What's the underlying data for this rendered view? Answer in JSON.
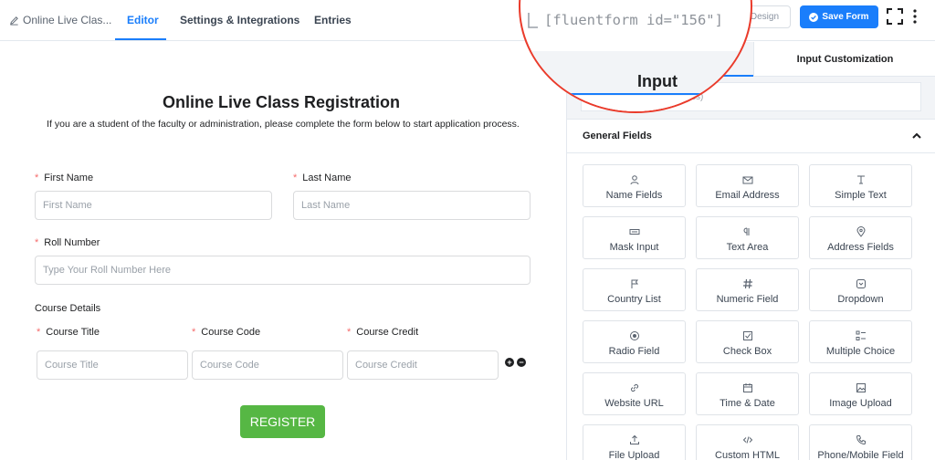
{
  "topbar": {
    "form_name": "Online Live Clas...",
    "tabs": [
      "Editor",
      "Settings & Integrations",
      "Entries"
    ],
    "preview_label": "Preview & Design",
    "save_label": "Save Form"
  },
  "form": {
    "title": "Online Live Class Registration",
    "description": "If you are a student of the faculty or administration, please complete the form below to start application process.",
    "first_name_label": "First Name",
    "first_name_placeholder": "First Name",
    "last_name_label": "Last Name",
    "last_name_placeholder": "Last Name",
    "roll_label": "Roll Number",
    "roll_placeholder": "Type Your Roll Number Here",
    "course_details_label": "Course Details",
    "course_title_label": "Course Title",
    "course_title_placeholder": "Course Title",
    "course_code_label": "Course Code",
    "course_code_placeholder": "Course Code",
    "course_credit_label": "Course Credit",
    "course_credit_placeholder": "Course Credit",
    "register_label": "REGISTER"
  },
  "sidebar": {
    "tab_input": "Input",
    "tab_customization": "Input Customization",
    "search_hint": "(Address)",
    "section_title": "General Fields",
    "fields": [
      {
        "label": "Name Fields",
        "icon": "user-icon"
      },
      {
        "label": "Email Address",
        "icon": "envelope-icon"
      },
      {
        "label": "Simple Text",
        "icon": "text-cursor-icon"
      },
      {
        "label": "Mask Input",
        "icon": "keyboard-icon"
      },
      {
        "label": "Text Area",
        "icon": "paragraph-icon"
      },
      {
        "label": "Address Fields",
        "icon": "map-pin-icon"
      },
      {
        "label": "Country List",
        "icon": "flag-icon"
      },
      {
        "label": "Numeric Field",
        "icon": "hash-icon"
      },
      {
        "label": "Dropdown",
        "icon": "dropdown-icon"
      },
      {
        "label": "Radio Field",
        "icon": "radio-icon"
      },
      {
        "label": "Check Box",
        "icon": "checkbox-icon"
      },
      {
        "label": "Multiple Choice",
        "icon": "list-icon"
      },
      {
        "label": "Website URL",
        "icon": "link-icon"
      },
      {
        "label": "Time & Date",
        "icon": "calendar-icon"
      },
      {
        "label": "Image Upload",
        "icon": "image-icon"
      },
      {
        "label": "File Upload",
        "icon": "upload-icon"
      },
      {
        "label": "Custom HTML",
        "icon": "code-icon"
      },
      {
        "label": "Phone/Mobile Field",
        "icon": "phone-icon"
      }
    ]
  },
  "magnifier": {
    "shortcode": "[fluentform id=\"156\"]"
  },
  "colors": {
    "accent": "#1a7efb",
    "register": "#56b744",
    "required": "#f56c6c",
    "callout": "#ea3b2b"
  }
}
